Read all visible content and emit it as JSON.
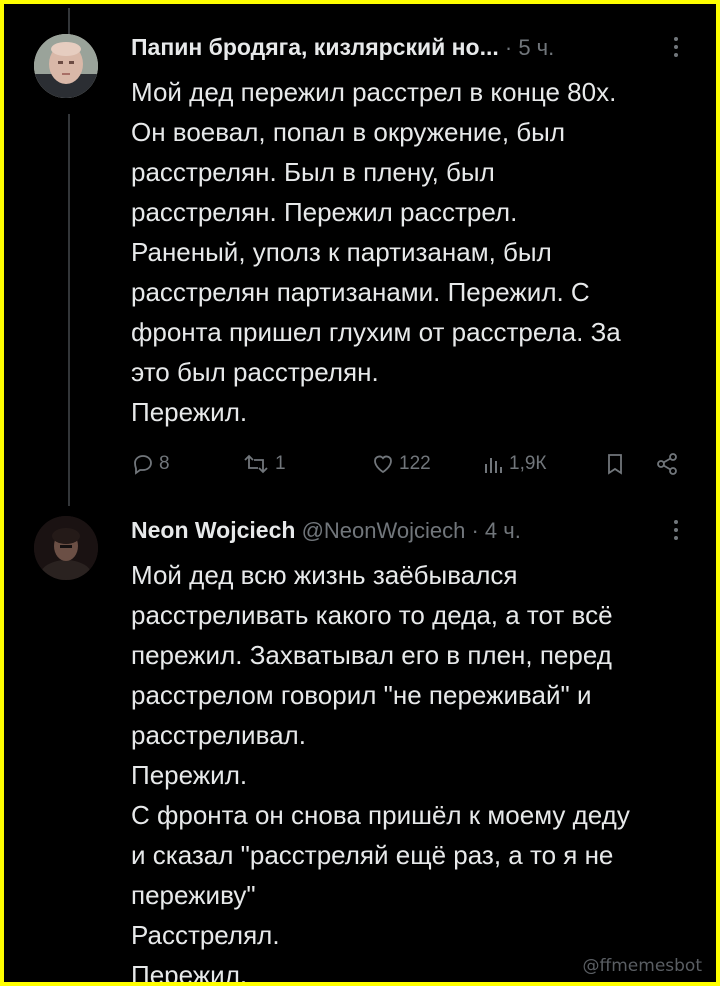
{
  "tweets": [
    {
      "author": "Папин бродяга, кизлярский но...",
      "separator": " · ",
      "time": "5 ч.",
      "more_icon": "ellipsis-vertical-icon",
      "text": "Мой дед пережил расстрел в конце 80х.\nОн воевал, попал в окружение, был\nрасстрелян. Был в плену, был\nрасстрелян. Пережил расстрел.\nРаненый, уполз к партизанам, был\nрасстрелян партизанами. Пережил. С\nфронта пришел глухим от расстрела. За\nэто был расстрелян.\nПережил.",
      "actions": {
        "replies": "8",
        "retweets": "1",
        "likes": "122",
        "views": "1,9К"
      }
    },
    {
      "author": "Neon Wojciech",
      "handle": "@NeonWojciech",
      "separator": " · ",
      "time": "4 ч.",
      "more_icon": "ellipsis-vertical-icon",
      "text": "Мой дед всю жизнь заёбывался\nрасстреливать какого то деда, а тот всё\nпережил. Захватывал его в плен, перед\nрасстрелом говорил \"не переживай\" и\nрасстреливал.\nПережил.\nС фронта он снова пришёл к моему деду\nи сказал \"расстреляй ещё раз, а то я не\nпереживу\"\nРасстрелял.\nПережил."
    }
  ],
  "watermark": "@ffmemesbot",
  "colors": {
    "background": "#000000",
    "border": "#ffff00",
    "text": "#e7e9ea",
    "muted": "#71767b"
  }
}
